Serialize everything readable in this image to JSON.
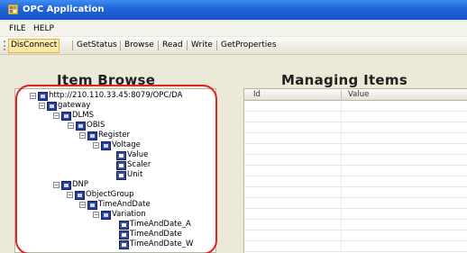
{
  "window": {
    "title": "OPC Application"
  },
  "menu": [
    "FILE",
    "HELP"
  ],
  "toolbar": [
    {
      "label": "DisConnect",
      "pressed": true
    },
    {
      "label": "GetStatus"
    },
    {
      "label": "Browse"
    },
    {
      "label": "Read"
    },
    {
      "label": "Write"
    },
    {
      "label": "GetProperties"
    }
  ],
  "item_browse": {
    "title": "Item Browse",
    "tree": [
      {
        "label": "http://210.110.33.45:8079/OPC/DA"
      },
      {
        "label": "gateway"
      },
      {
        "label": "DLMS"
      },
      {
        "label": "OBIS"
      },
      {
        "label": "Register"
      },
      {
        "label": "Voltage"
      },
      {
        "label": "Value"
      },
      {
        "label": "Scaler"
      },
      {
        "label": "Unit"
      },
      {
        "label": "DNP"
      },
      {
        "label": "ObjectGroup"
      },
      {
        "label": "TimeAndDate"
      },
      {
        "label": "Variation"
      },
      {
        "label": "TimeAndDate_A"
      },
      {
        "label": "TimeAndDate"
      },
      {
        "label": "TimeAndDate_W"
      }
    ]
  },
  "managing_items": {
    "title": "Managing Items",
    "columns": [
      "Id",
      "Value"
    ]
  },
  "colors": {
    "titlebar": "#1f63d8",
    "highlight_ring": "#e02222",
    "toolbar_pressed": "#fbe9a6"
  }
}
